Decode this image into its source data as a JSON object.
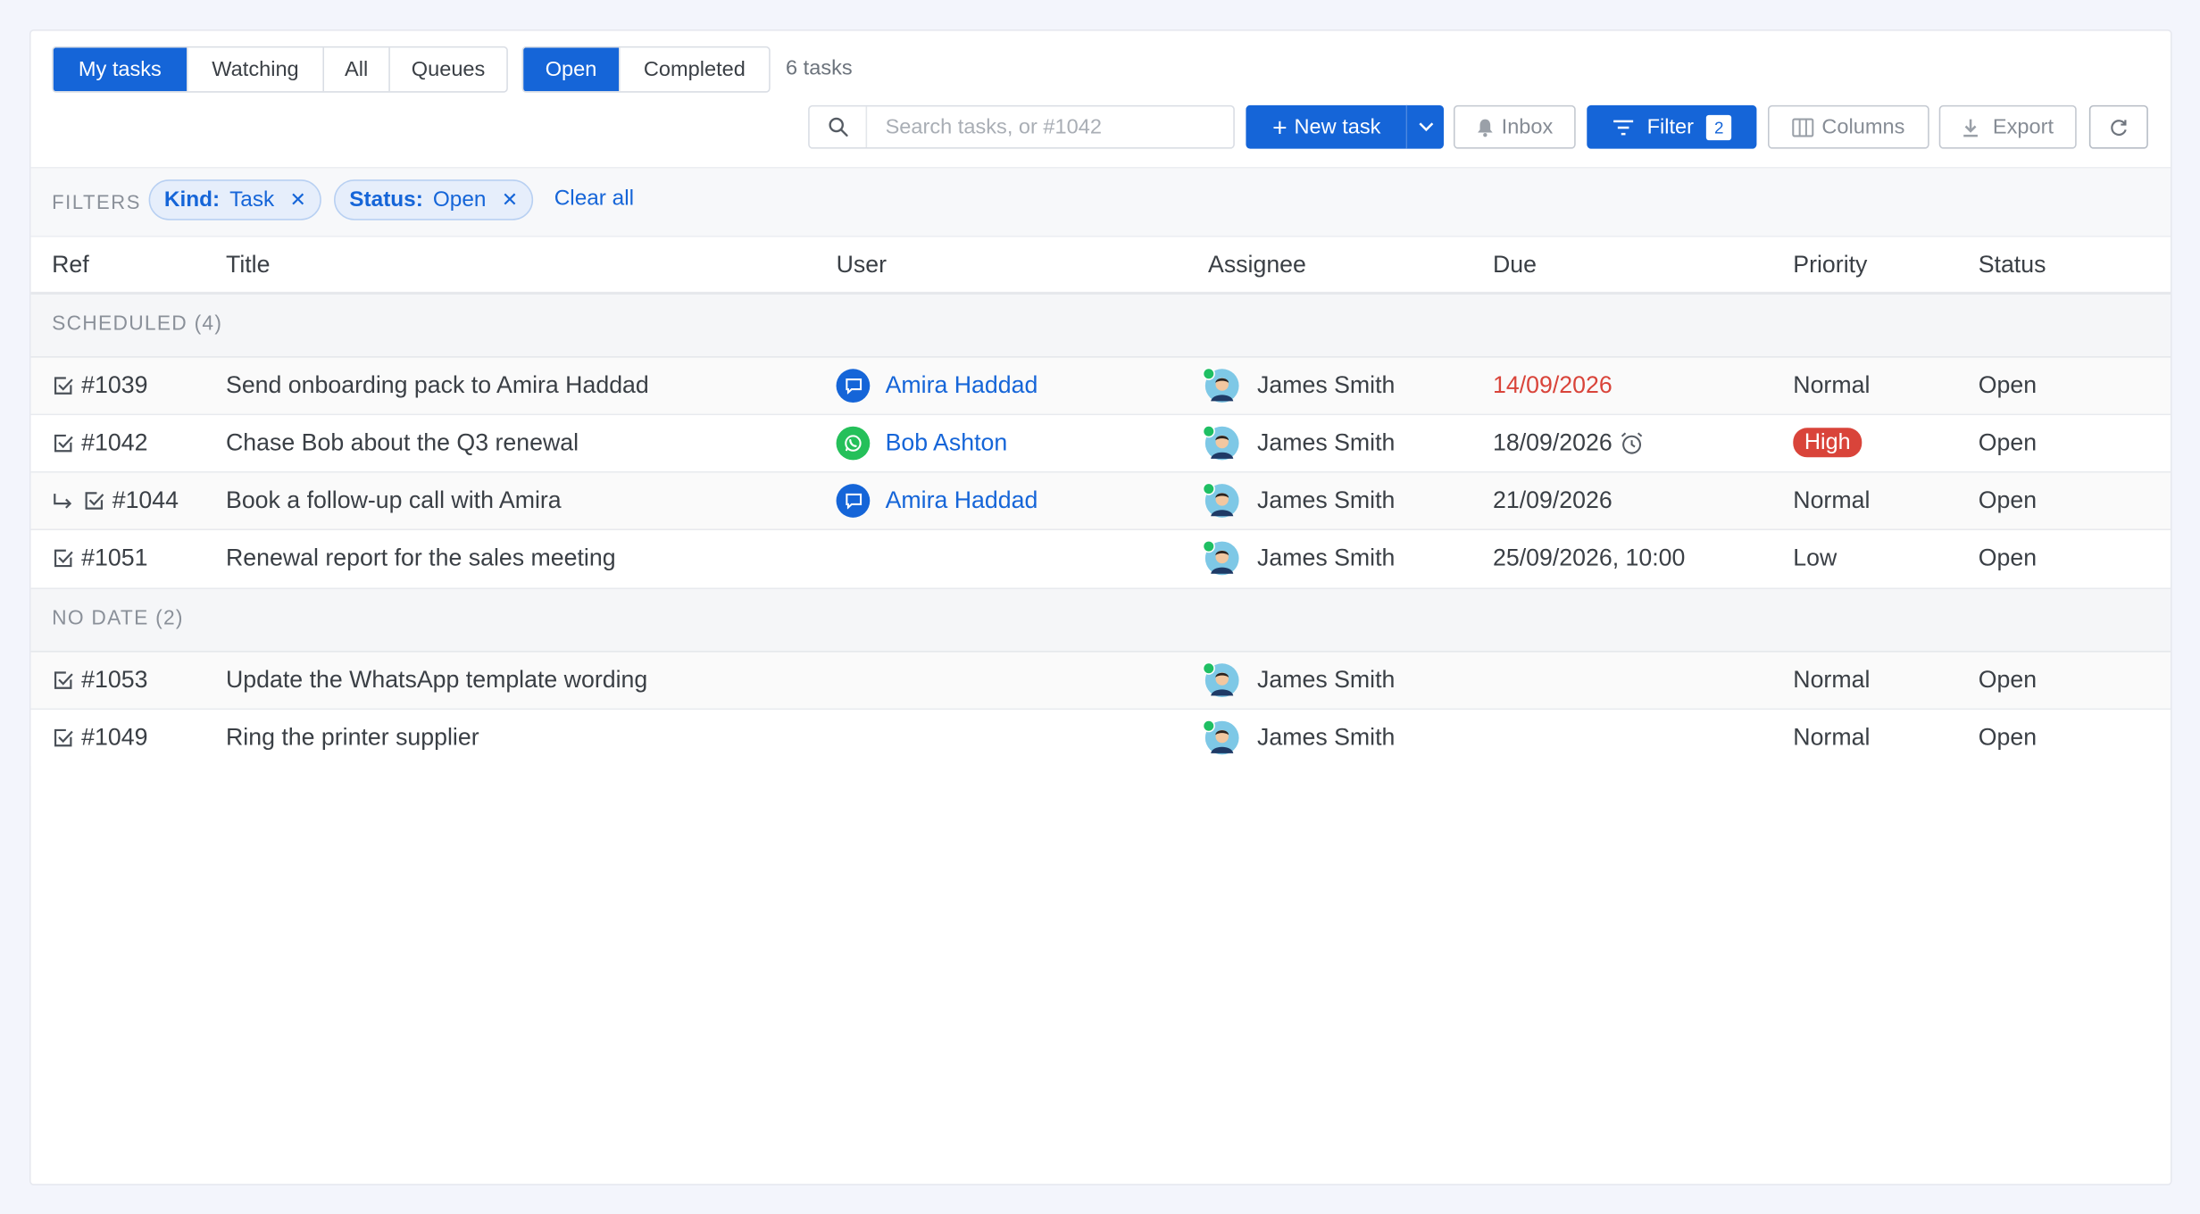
{
  "top_tabs": {
    "my_tasks": "My tasks",
    "watching": "Watching",
    "all": "All",
    "queues": "Queues"
  },
  "state_tabs": {
    "open": "Open",
    "completed": "Completed"
  },
  "task_count": "6 tasks",
  "search": {
    "placeholder": "Search tasks, or #1042"
  },
  "toolbar": {
    "new_task": "New task",
    "inbox": "Inbox",
    "filter": "Filter",
    "filter_count": "2",
    "columns": "Columns",
    "export": "Export"
  },
  "filters": {
    "label": "FILTERS",
    "chips": [
      {
        "key": "Kind:",
        "value": "Task"
      },
      {
        "key": "Status:",
        "value": "Open"
      }
    ],
    "clear_all": "Clear all"
  },
  "columns": [
    "Ref",
    "Title",
    "User",
    "Assignee",
    "Due",
    "Priority",
    "Status"
  ],
  "groups": [
    {
      "label": "SCHEDULED (4)"
    },
    {
      "label": "NO DATE (2)"
    }
  ],
  "rows": [
    {
      "ref": "#1039",
      "title": "Send onboarding pack to Amira Haddad",
      "user": "Amira Haddad",
      "user_channel": "chat-icon",
      "assignee": "James Smith",
      "due": "14/09/2026",
      "due_overdue": true,
      "priority": "Normal",
      "status": "Open"
    },
    {
      "ref": "#1042",
      "title": "Chase Bob about the Q3 renewal",
      "user": "Bob Ashton",
      "user_channel": "whatsapp-icon",
      "assignee": "James Smith",
      "due": "18/09/2026",
      "due_reminder": true,
      "priority": "High",
      "status": "Open"
    },
    {
      "ref": "#1044",
      "title": "Book a follow-up call with Amira",
      "user": "Amira Haddad",
      "user_channel": "chat-icon",
      "subtask": true,
      "assignee": "James Smith",
      "due": "21/09/2026",
      "priority": "Normal",
      "status": "Open"
    },
    {
      "ref": "#1051",
      "title": "Renewal report for the sales meeting",
      "user": "",
      "assignee": "James Smith",
      "due": "25/09/2026, 10:00",
      "priority": "Low",
      "status": "Open"
    },
    {
      "ref": "#1053",
      "title": "Update the WhatsApp template wording",
      "user": "",
      "assignee": "James Smith",
      "due": "",
      "priority": "Normal",
      "status": "Open"
    },
    {
      "ref": "#1049",
      "title": "Ring the printer supplier",
      "user": "",
      "assignee": "James Smith",
      "due": "",
      "priority": "Normal",
      "status": "Open"
    }
  ],
  "colors": {
    "accent": "#1565d8",
    "danger": "#d9443a",
    "online": "#1fbf63",
    "whatsapp": "#25c05a"
  }
}
